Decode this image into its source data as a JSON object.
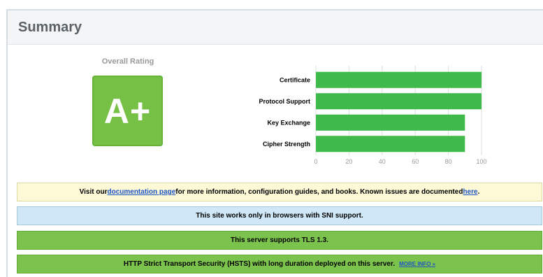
{
  "header": {
    "title": "Summary"
  },
  "rating": {
    "label": "Overall Rating",
    "grade": "A+",
    "grade_color": "#75c045"
  },
  "chart_data": {
    "type": "bar",
    "orientation": "horizontal",
    "categories": [
      "Certificate",
      "Protocol Support",
      "Key Exchange",
      "Cipher Strength"
    ],
    "values": [
      100,
      100,
      90,
      90
    ],
    "xlim": [
      0,
      100
    ],
    "xticks": [
      "0",
      "20",
      "40",
      "60",
      "80",
      "100"
    ],
    "bar_color": "#3dba4a",
    "grid": true
  },
  "notices": {
    "documentation": {
      "prefix": "Visit our ",
      "link1": "documentation page",
      "middle": " for more information, configuration guides, and books. Known issues are documented ",
      "link2": "here",
      "suffix": "."
    },
    "sni": "This site works only in browsers with SNI support.",
    "tls": "This server supports TLS 1.3.",
    "hsts": {
      "text": "HTTP Strict Transport Security (HSTS) with long duration deployed on this server.",
      "link": "MORE INFO »"
    }
  }
}
